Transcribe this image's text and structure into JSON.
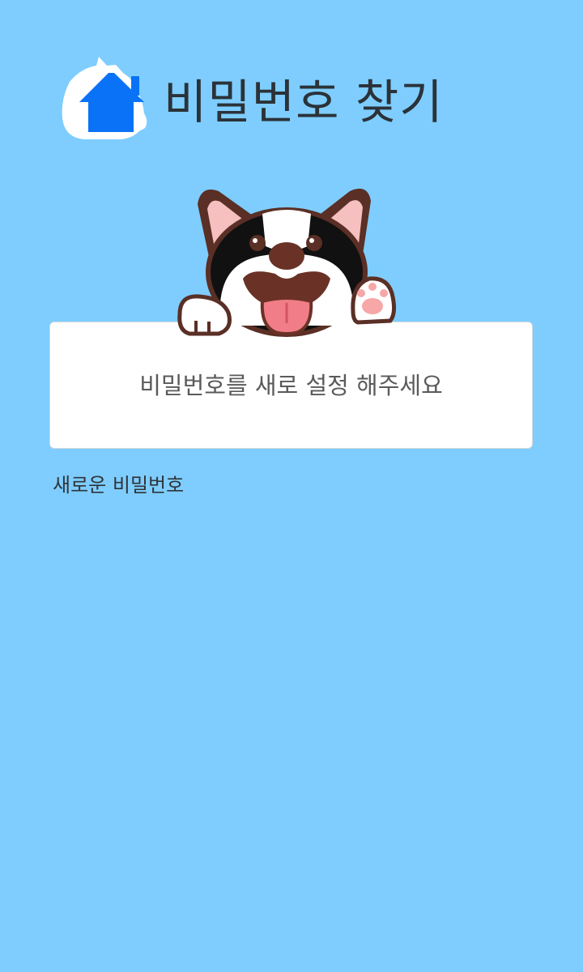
{
  "theme": {
    "background": "#7ecdfe",
    "brand_blue": "#0a72f6",
    "card_background": "#ffffff"
  },
  "header": {
    "logo_icon": "home-cat-logo-icon",
    "title": "비밀번호 찾기"
  },
  "illustration": {
    "icon": "waving-dog-icon"
  },
  "message_card": {
    "text": "비밀번호를 새로 설정 해주세요"
  },
  "form": {
    "new_password_label": "새로운 비밀번호"
  }
}
